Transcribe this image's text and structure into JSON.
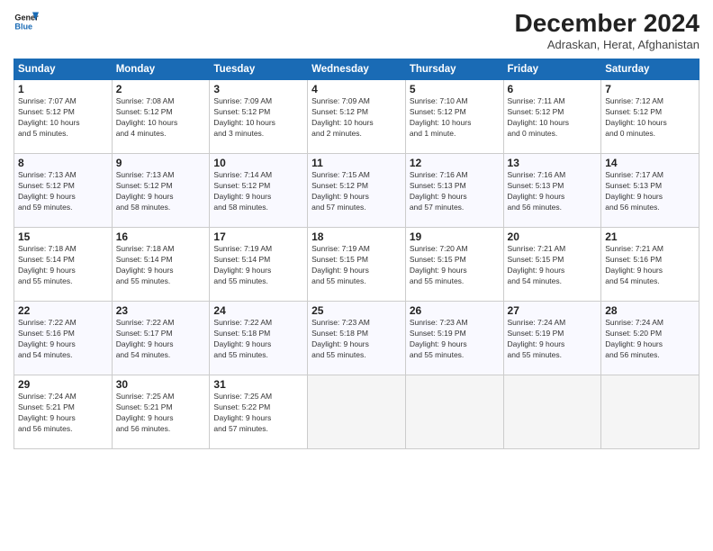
{
  "header": {
    "logo_line1": "General",
    "logo_line2": "Blue",
    "month_title": "December 2024",
    "subtitle": "Adraskan, Herat, Afghanistan"
  },
  "weekdays": [
    "Sunday",
    "Monday",
    "Tuesday",
    "Wednesday",
    "Thursday",
    "Friday",
    "Saturday"
  ],
  "weeks": [
    [
      {
        "day": "1",
        "sunrise": "Sunrise: 7:07 AM",
        "sunset": "Sunset: 5:12 PM",
        "daylight": "Daylight: 10 hours and 5 minutes."
      },
      {
        "day": "2",
        "sunrise": "Sunrise: 7:08 AM",
        "sunset": "Sunset: 5:12 PM",
        "daylight": "Daylight: 10 hours and 4 minutes."
      },
      {
        "day": "3",
        "sunrise": "Sunrise: 7:09 AM",
        "sunset": "Sunset: 5:12 PM",
        "daylight": "Daylight: 10 hours and 3 minutes."
      },
      {
        "day": "4",
        "sunrise": "Sunrise: 7:09 AM",
        "sunset": "Sunset: 5:12 PM",
        "daylight": "Daylight: 10 hours and 2 minutes."
      },
      {
        "day": "5",
        "sunrise": "Sunrise: 7:10 AM",
        "sunset": "Sunset: 5:12 PM",
        "daylight": "Daylight: 10 hours and 1 minute."
      },
      {
        "day": "6",
        "sunrise": "Sunrise: 7:11 AM",
        "sunset": "Sunset: 5:12 PM",
        "daylight": "Daylight: 10 hours and 0 minutes."
      },
      {
        "day": "7",
        "sunrise": "Sunrise: 7:12 AM",
        "sunset": "Sunset: 5:12 PM",
        "daylight": "Daylight: 10 hours and 0 minutes."
      }
    ],
    [
      {
        "day": "8",
        "sunrise": "Sunrise: 7:13 AM",
        "sunset": "Sunset: 5:12 PM",
        "daylight": "Daylight: 9 hours and 59 minutes."
      },
      {
        "day": "9",
        "sunrise": "Sunrise: 7:13 AM",
        "sunset": "Sunset: 5:12 PM",
        "daylight": "Daylight: 9 hours and 58 minutes."
      },
      {
        "day": "10",
        "sunrise": "Sunrise: 7:14 AM",
        "sunset": "Sunset: 5:12 PM",
        "daylight": "Daylight: 9 hours and 58 minutes."
      },
      {
        "day": "11",
        "sunrise": "Sunrise: 7:15 AM",
        "sunset": "Sunset: 5:12 PM",
        "daylight": "Daylight: 9 hours and 57 minutes."
      },
      {
        "day": "12",
        "sunrise": "Sunrise: 7:16 AM",
        "sunset": "Sunset: 5:13 PM",
        "daylight": "Daylight: 9 hours and 57 minutes."
      },
      {
        "day": "13",
        "sunrise": "Sunrise: 7:16 AM",
        "sunset": "Sunset: 5:13 PM",
        "daylight": "Daylight: 9 hours and 56 minutes."
      },
      {
        "day": "14",
        "sunrise": "Sunrise: 7:17 AM",
        "sunset": "Sunset: 5:13 PM",
        "daylight": "Daylight: 9 hours and 56 minutes."
      }
    ],
    [
      {
        "day": "15",
        "sunrise": "Sunrise: 7:18 AM",
        "sunset": "Sunset: 5:14 PM",
        "daylight": "Daylight: 9 hours and 55 minutes."
      },
      {
        "day": "16",
        "sunrise": "Sunrise: 7:18 AM",
        "sunset": "Sunset: 5:14 PM",
        "daylight": "Daylight: 9 hours and 55 minutes."
      },
      {
        "day": "17",
        "sunrise": "Sunrise: 7:19 AM",
        "sunset": "Sunset: 5:14 PM",
        "daylight": "Daylight: 9 hours and 55 minutes."
      },
      {
        "day": "18",
        "sunrise": "Sunrise: 7:19 AM",
        "sunset": "Sunset: 5:15 PM",
        "daylight": "Daylight: 9 hours and 55 minutes."
      },
      {
        "day": "19",
        "sunrise": "Sunrise: 7:20 AM",
        "sunset": "Sunset: 5:15 PM",
        "daylight": "Daylight: 9 hours and 55 minutes."
      },
      {
        "day": "20",
        "sunrise": "Sunrise: 7:21 AM",
        "sunset": "Sunset: 5:15 PM",
        "daylight": "Daylight: 9 hours and 54 minutes."
      },
      {
        "day": "21",
        "sunrise": "Sunrise: 7:21 AM",
        "sunset": "Sunset: 5:16 PM",
        "daylight": "Daylight: 9 hours and 54 minutes."
      }
    ],
    [
      {
        "day": "22",
        "sunrise": "Sunrise: 7:22 AM",
        "sunset": "Sunset: 5:16 PM",
        "daylight": "Daylight: 9 hours and 54 minutes."
      },
      {
        "day": "23",
        "sunrise": "Sunrise: 7:22 AM",
        "sunset": "Sunset: 5:17 PM",
        "daylight": "Daylight: 9 hours and 54 minutes."
      },
      {
        "day": "24",
        "sunrise": "Sunrise: 7:22 AM",
        "sunset": "Sunset: 5:18 PM",
        "daylight": "Daylight: 9 hours and 55 minutes."
      },
      {
        "day": "25",
        "sunrise": "Sunrise: 7:23 AM",
        "sunset": "Sunset: 5:18 PM",
        "daylight": "Daylight: 9 hours and 55 minutes."
      },
      {
        "day": "26",
        "sunrise": "Sunrise: 7:23 AM",
        "sunset": "Sunset: 5:19 PM",
        "daylight": "Daylight: 9 hours and 55 minutes."
      },
      {
        "day": "27",
        "sunrise": "Sunrise: 7:24 AM",
        "sunset": "Sunset: 5:19 PM",
        "daylight": "Daylight: 9 hours and 55 minutes."
      },
      {
        "day": "28",
        "sunrise": "Sunrise: 7:24 AM",
        "sunset": "Sunset: 5:20 PM",
        "daylight": "Daylight: 9 hours and 56 minutes."
      }
    ],
    [
      {
        "day": "29",
        "sunrise": "Sunrise: 7:24 AM",
        "sunset": "Sunset: 5:21 PM",
        "daylight": "Daylight: 9 hours and 56 minutes."
      },
      {
        "day": "30",
        "sunrise": "Sunrise: 7:25 AM",
        "sunset": "Sunset: 5:21 PM",
        "daylight": "Daylight: 9 hours and 56 minutes."
      },
      {
        "day": "31",
        "sunrise": "Sunrise: 7:25 AM",
        "sunset": "Sunset: 5:22 PM",
        "daylight": "Daylight: 9 hours and 57 minutes."
      },
      null,
      null,
      null,
      null
    ]
  ]
}
